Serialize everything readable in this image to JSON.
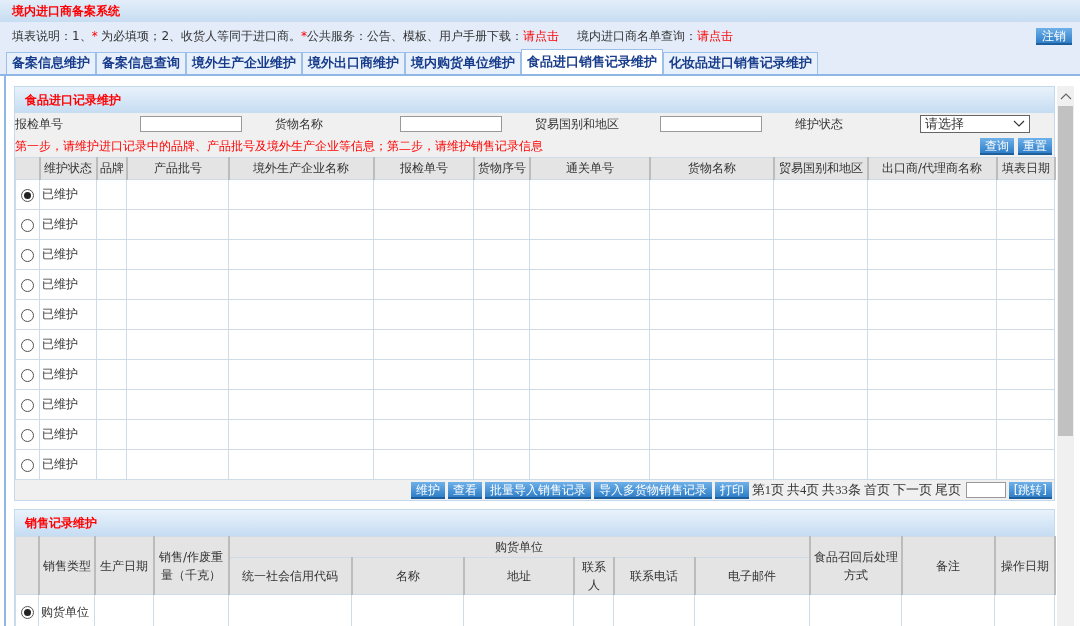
{
  "header": {
    "title": "境内进口商备案系统"
  },
  "info": {
    "label": "填表说明：1、",
    "required_mark": "*",
    "text1": "为必填项；2、收货人等同于进口商。",
    "service_mark": "*",
    "text2": "公共服务：公告、模板、用户手册下载：",
    "link1": "请点击",
    "text3": "境内进口商名单查询：",
    "link2": "请点击",
    "logout": "注销"
  },
  "tabs": [
    {
      "label": "备案信息维护",
      "selected": false
    },
    {
      "label": "备案信息查询",
      "selected": false
    },
    {
      "label": "境外生产企业维护",
      "selected": false
    },
    {
      "label": "境外出口商维护",
      "selected": false
    },
    {
      "label": "境内购货单位维护",
      "selected": false
    },
    {
      "label": "食品进口销售记录维护",
      "selected": true
    },
    {
      "label": "化妆品进口销售记录维护",
      "selected": false
    }
  ],
  "import_panel": {
    "title": "食品进口记录维护",
    "filters": [
      {
        "label": "报检单号",
        "kind": "text"
      },
      {
        "label": "货物名称",
        "kind": "text"
      },
      {
        "label": "贸易国别和地区",
        "kind": "text"
      },
      {
        "label": "维护状态",
        "kind": "select",
        "value": "请选择"
      }
    ],
    "note": "第一步，请维护进口记录中的品牌、产品批号及境外生产企业等信息；第二步，请维护销售记录信息",
    "buttons": [
      "查询",
      "重置"
    ],
    "table": {
      "columns": [
        "维护状态",
        "品牌",
        "产品批号",
        "境外生产企业名称",
        "报检单号",
        "货物序号",
        "通关单号",
        "货物名称",
        "贸易国别和地区",
        "出口商/代理商名称",
        "填表日期"
      ],
      "rows": [
        {
          "status": "已维护",
          "selected": true
        },
        {
          "status": "已维护",
          "selected": false
        },
        {
          "status": "已维护",
          "selected": false
        },
        {
          "status": "已维护",
          "selected": false
        },
        {
          "status": "已维护",
          "selected": false
        },
        {
          "status": "已维护",
          "selected": false
        },
        {
          "status": "已维护",
          "selected": false
        },
        {
          "status": "已维护",
          "selected": false
        },
        {
          "status": "已维护",
          "selected": false
        },
        {
          "status": "已维护",
          "selected": false
        }
      ]
    },
    "actions": [
      "维护",
      "查看",
      "批量导入销售记录",
      "导入多货物销售记录",
      "打印"
    ],
    "pagination": {
      "page": "第1页",
      "pages": "共4页",
      "count": "共33条",
      "first": "首页",
      "next": "下一页",
      "last": "尾页",
      "jump": "[跳转]"
    }
  },
  "sales_panel": {
    "title": "销售记录维护",
    "table": {
      "columns_before": [
        "销售类型",
        "生产日期",
        "销售/作废重量（千克）"
      ],
      "group": {
        "label": "购货单位",
        "columns": [
          "统一社会信用代码",
          "名称",
          "地址",
          "联系人",
          "联系电话",
          "电子邮件"
        ]
      },
      "columns_after": [
        "食品召回后处理方式",
        "备注",
        "操作日期"
      ],
      "rows": [
        {
          "type": "购货单位",
          "selected": true
        }
      ]
    }
  }
}
